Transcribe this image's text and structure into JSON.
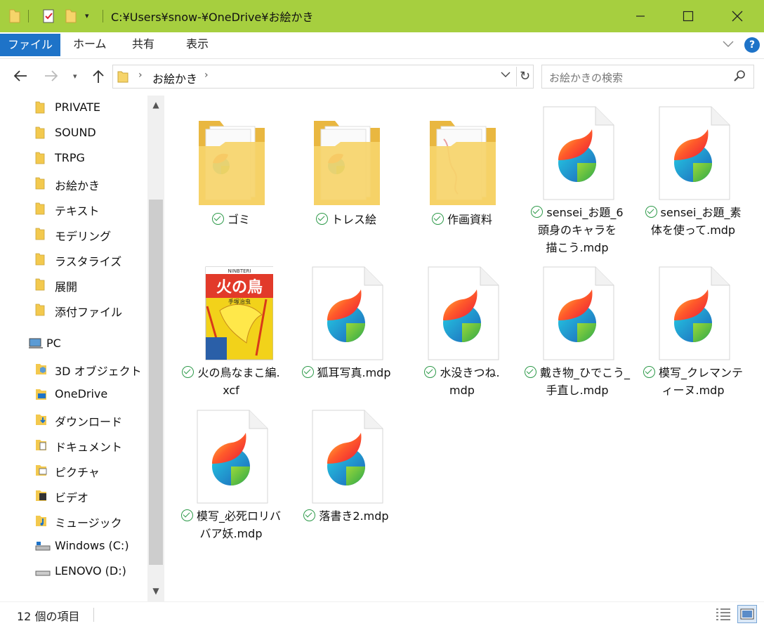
{
  "window": {
    "path": "C:¥Users¥snow-¥OneDrive¥お絵かき",
    "accent": "#a6cf3f"
  },
  "ribbon": {
    "tabs": [
      "ファイル",
      "ホーム",
      "共有",
      "表示"
    ],
    "help": "?"
  },
  "address": {
    "crumb": "お絵かき"
  },
  "search": {
    "placeholder": "お絵かきの検索"
  },
  "sidebar": {
    "folders": [
      "PRIVATE",
      "SOUND",
      "TRPG",
      "お絵かき",
      "テキスト",
      "モデリング",
      "ラスタライズ",
      "展開",
      "添付ファイル"
    ],
    "pc": "PC",
    "pc_items": [
      "3D オブジェクト",
      "OneDrive",
      "ダウンロード",
      "ドキュメント",
      "ピクチャ",
      "ビデオ",
      "ミュージック",
      "Windows (C:)",
      "LENOVO (D:)"
    ]
  },
  "files": [
    {
      "name": "ゴミ",
      "kind": "folder"
    },
    {
      "name": "トレス絵",
      "kind": "folder"
    },
    {
      "name": "作画資料",
      "kind": "folder"
    },
    {
      "name": "sensei_お題_6頭身のキャラを描こう.mdp",
      "kind": "mdp"
    },
    {
      "name": "sensei_お題_素体を使って.mdp",
      "kind": "mdp"
    },
    {
      "name": "火の鳥なまこ編.xcf",
      "kind": "xcf"
    },
    {
      "name": "狐耳写真.mdp",
      "kind": "mdp"
    },
    {
      "name": "水没きつね.mdp",
      "kind": "mdp"
    },
    {
      "name": "戴き物_ひでこう_手直し.mdp",
      "kind": "mdp"
    },
    {
      "name": "模写_クレマンティーヌ.mdp",
      "kind": "mdp"
    },
    {
      "name": "模写_必死ロリババア妖.mdp",
      "kind": "mdp"
    },
    {
      "name": "落書き2.mdp",
      "kind": "mdp"
    }
  ],
  "captions": [
    [
      "ゴミ"
    ],
    [
      "トレス絵"
    ],
    [
      "作画資料"
    ],
    [
      "sensei_お題_6",
      "頭身のキャラを",
      "描こう.mdp"
    ],
    [
      "sensei_お題_素",
      "体を使って.mdp"
    ],
    [
      "火の鳥なまこ編.",
      "xcf"
    ],
    [
      "狐耳写真.mdp"
    ],
    [
      "水没きつね.",
      "mdp"
    ],
    [
      "戴き物_ひでこう_",
      "手直し.mdp"
    ],
    [
      "模写_クレマンテ",
      "ィーヌ.mdp"
    ],
    [
      "模写_必死ロリバ",
      "バア妖.mdp"
    ],
    [
      "落書き2.mdp"
    ]
  ],
  "cover": {
    "title": "火の鳥",
    "top": "NINBTERI",
    "author": "手塚治虫"
  },
  "status": {
    "count": "12 個の項目"
  }
}
